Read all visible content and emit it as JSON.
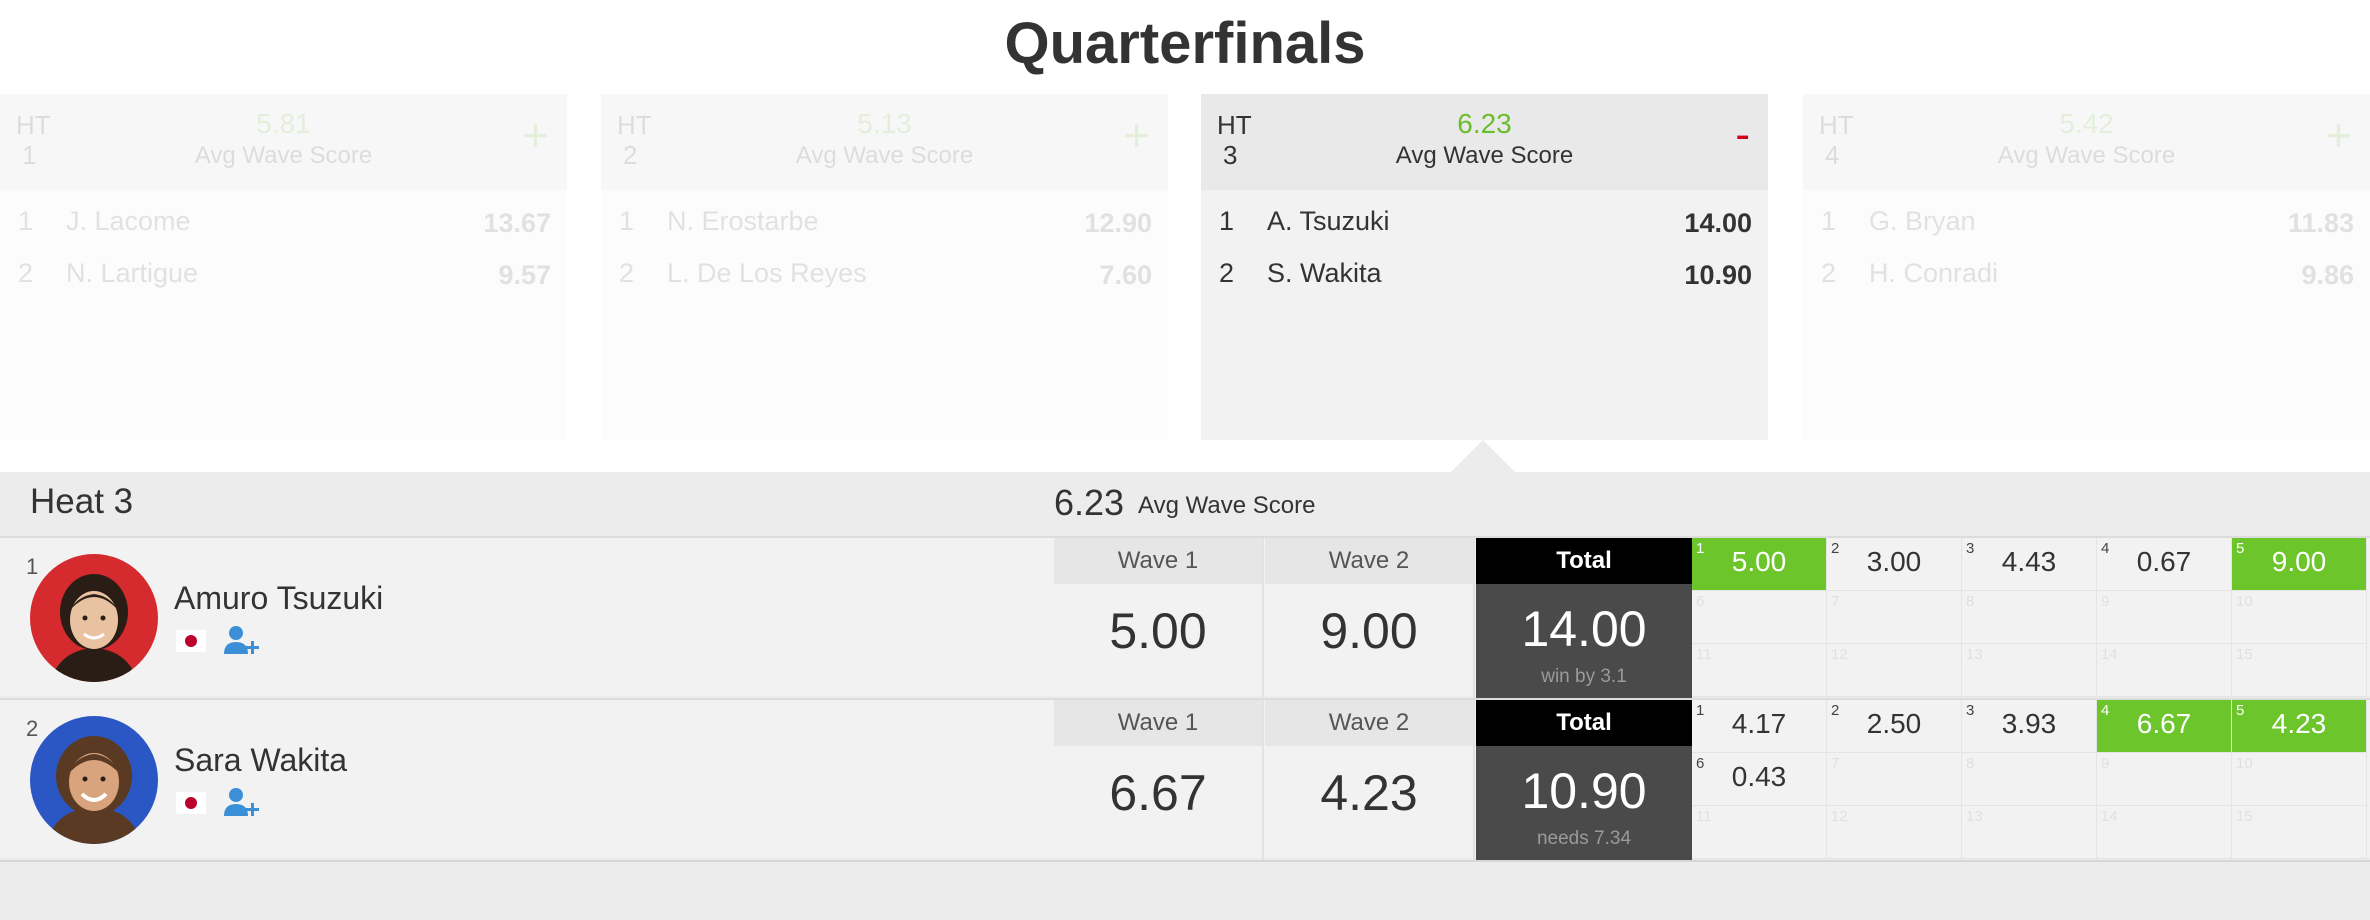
{
  "round": {
    "title": "Quarterfinals"
  },
  "heats": [
    {
      "ht": "HT",
      "num": "1",
      "avg": "5.81",
      "avg_label": "Avg Wave Score",
      "toggle": "+",
      "rows": [
        {
          "rank": "1",
          "name": "J. Lacome",
          "score": "13.67"
        },
        {
          "rank": "2",
          "name": "N. Lartigue",
          "score": "9.57"
        }
      ]
    },
    {
      "ht": "HT",
      "num": "2",
      "avg": "5.13",
      "avg_label": "Avg Wave Score",
      "toggle": "+",
      "rows": [
        {
          "rank": "1",
          "name": "N. Erostarbe",
          "score": "12.90"
        },
        {
          "rank": "2",
          "name": "L. De Los Reyes",
          "score": "7.60"
        }
      ]
    },
    {
      "ht": "HT",
      "num": "3",
      "avg": "6.23",
      "avg_label": "Avg Wave Score",
      "toggle": "-",
      "rows": [
        {
          "rank": "1",
          "name": "A. Tsuzuki",
          "score": "14.00"
        },
        {
          "rank": "2",
          "name": "S. Wakita",
          "score": "10.90"
        }
      ]
    },
    {
      "ht": "HT",
      "num": "4",
      "avg": "5.42",
      "avg_label": "Avg Wave Score",
      "toggle": "+",
      "rows": [
        {
          "rank": "1",
          "name": "G. Bryan",
          "score": "11.83"
        },
        {
          "rank": "2",
          "name": "H. Conradi",
          "score": "9.86"
        }
      ]
    }
  ],
  "detail": {
    "heat_name": "Heat 3",
    "avg": "6.23",
    "avg_label": "Avg Wave Score",
    "surfers": [
      {
        "place": "1",
        "name": "Amuro Tsuzuki",
        "wave1_label": "Wave 1",
        "wave1": "5.00",
        "wave2_label": "Wave 2",
        "wave2": "9.00",
        "total_label": "Total",
        "total": "14.00",
        "note": "win by 3.1",
        "waves": [
          {
            "i": "1",
            "v": "5.00"
          },
          {
            "i": "2",
            "v": "3.00"
          },
          {
            "i": "3",
            "v": "4.43"
          },
          {
            "i": "4",
            "v": "0.67"
          },
          {
            "i": "5",
            "v": "9.00"
          },
          {
            "i": "6",
            "v": ""
          },
          {
            "i": "7",
            "v": ""
          },
          {
            "i": "8",
            "v": ""
          },
          {
            "i": "9",
            "v": ""
          },
          {
            "i": "10",
            "v": ""
          },
          {
            "i": "11",
            "v": ""
          },
          {
            "i": "12",
            "v": ""
          },
          {
            "i": "13",
            "v": ""
          },
          {
            "i": "14",
            "v": ""
          },
          {
            "i": "15",
            "v": ""
          }
        ]
      },
      {
        "place": "2",
        "name": "Sara Wakita",
        "wave1_label": "Wave 1",
        "wave1": "6.67",
        "wave2_label": "Wave 2",
        "wave2": "4.23",
        "total_label": "Total",
        "total": "10.90",
        "note": "needs 7.34",
        "waves": [
          {
            "i": "1",
            "v": "4.17"
          },
          {
            "i": "2",
            "v": "2.50"
          },
          {
            "i": "3",
            "v": "3.93"
          },
          {
            "i": "4",
            "v": "6.67"
          },
          {
            "i": "5",
            "v": "4.23"
          },
          {
            "i": "6",
            "v": "0.43"
          },
          {
            "i": "7",
            "v": ""
          },
          {
            "i": "8",
            "v": ""
          },
          {
            "i": "9",
            "v": ""
          },
          {
            "i": "10",
            "v": ""
          },
          {
            "i": "11",
            "v": ""
          },
          {
            "i": "12",
            "v": ""
          },
          {
            "i": "13",
            "v": ""
          },
          {
            "i": "14",
            "v": ""
          },
          {
            "i": "15",
            "v": ""
          }
        ]
      }
    ]
  },
  "colors": {
    "accent_green": "#6cc62b",
    "minus_red": "#d0021b",
    "avatar_red": "#d52b2f",
    "avatar_blue": "#2a57c4"
  }
}
